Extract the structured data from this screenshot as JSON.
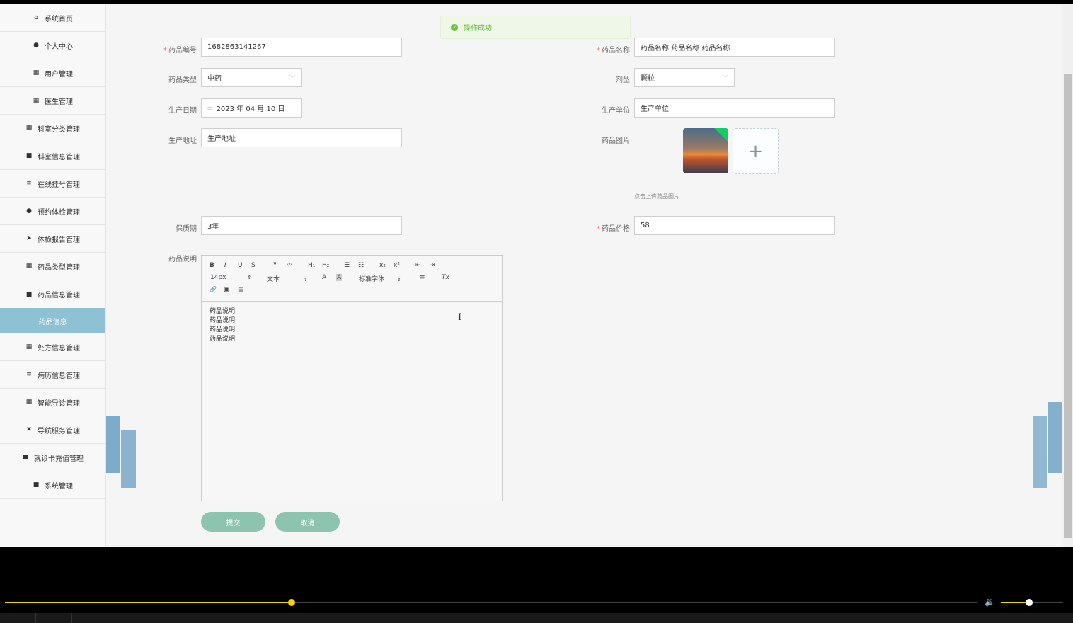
{
  "sidebar": {
    "items": [
      {
        "label": "系统首页",
        "icon": "⌂"
      },
      {
        "label": "个人中心",
        "icon": "●"
      },
      {
        "label": "用户管理",
        "icon": "▦"
      },
      {
        "label": "医生管理",
        "icon": "▦"
      },
      {
        "label": "科室分类管理",
        "icon": "▦"
      },
      {
        "label": "科室信息管理",
        "icon": "■"
      },
      {
        "label": "在线挂号管理",
        "icon": "≡"
      },
      {
        "label": "预约体检管理",
        "icon": "●"
      },
      {
        "label": "体检报告管理",
        "icon": "➤"
      },
      {
        "label": "药品类型管理",
        "icon": "▦"
      },
      {
        "label": "药品信息管理",
        "icon": "■"
      }
    ],
    "active_sub": "药品信息",
    "items_after": [
      {
        "label": "处方信息管理",
        "icon": "▦"
      },
      {
        "label": "病历信息管理",
        "icon": "≡"
      },
      {
        "label": "智能导诊管理",
        "icon": "▦"
      },
      {
        "label": "导航服务管理",
        "icon": "✖"
      },
      {
        "label": "就诊卡充值管理",
        "icon": "■"
      },
      {
        "label": "系统管理",
        "icon": "■"
      }
    ]
  },
  "toast": {
    "message": "操作成功",
    "icon": "✓"
  },
  "form": {
    "code_label": "药品编号",
    "code_value": "1682863141267",
    "name_label": "药品名称",
    "name_value": "药品名称 药品名称 药品名称",
    "type_label": "药品类型",
    "type_value": "中药",
    "form_label": "剂型",
    "form_value": "颗粒",
    "date_label": "生产日期",
    "date_value": "2023 年 04 月 10 日",
    "unit_label": "生产单位",
    "unit_value": "生产单位",
    "address_label": "生产地址",
    "address_value": "生产地址",
    "image_label": "药品图片",
    "image_hint": "点击上传药品图片",
    "shelf_label": "保质期",
    "shelf_value": "3年",
    "price_label": "药品价格",
    "price_value": "58",
    "desc_label": "药品说明",
    "required_mark": "*"
  },
  "editor": {
    "toolbar": {
      "bold": "B",
      "italic": "I",
      "underline": "U",
      "strike": "S",
      "quote": "❞",
      "code": "‹/›",
      "h1": "H₁",
      "h2": "H₂",
      "ol": "☰",
      "ul": "☷",
      "sub": "x₂",
      "sup": "x²",
      "outdent": "⇤",
      "indent": "⇥",
      "size": "14px",
      "header": "文本",
      "font": "标准字体",
      "color": "A",
      "bg": "A",
      "align": "≡",
      "clean": "Tx",
      "link": "🔗",
      "image": "▣",
      "video": "▤"
    },
    "lines": [
      "药品说明",
      "药品说明",
      "药品说明",
      "药品说明"
    ]
  },
  "buttons": {
    "submit": "提交",
    "cancel": "取消"
  },
  "player": {
    "progress_fraction": 0.295,
    "volume_fraction": 0.45,
    "volume_icon": "🔉"
  },
  "colors": {
    "active_nav": "#8fc1d4",
    "button": "#8cc4b0",
    "toast_text": "#67c23a",
    "progress": "#f5d20a"
  }
}
